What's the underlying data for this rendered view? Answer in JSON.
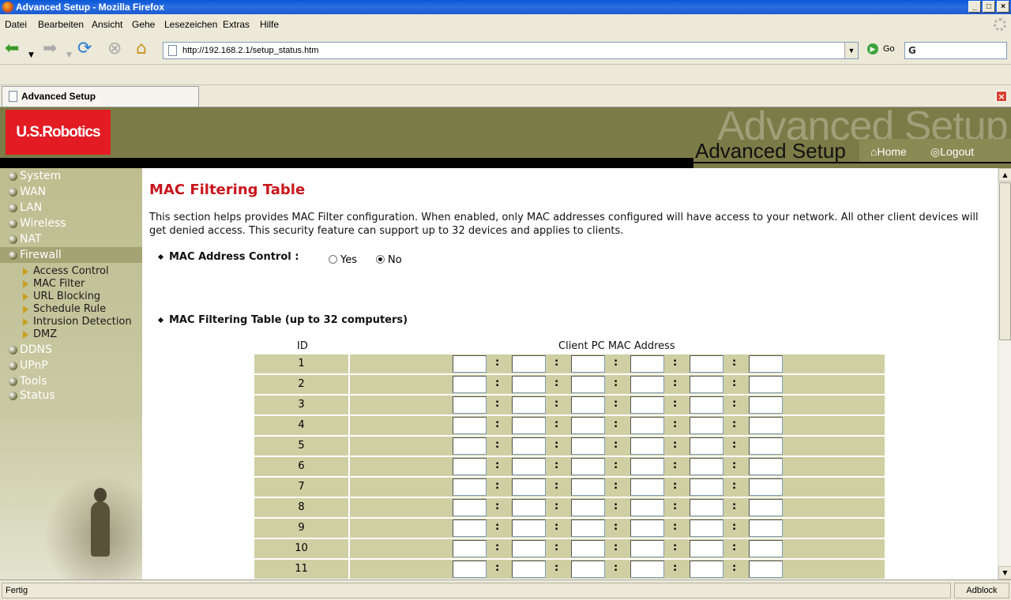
{
  "window": {
    "title": "Advanced Setup - Mozilla Firefox"
  },
  "menu": [
    "Datei",
    "Bearbeiten",
    "Ansicht",
    "Gehe",
    "Lesezeichen",
    "Extras",
    "Hilfe"
  ],
  "toolbar": {
    "url": "http://192.168.2.1/setup_status.htm",
    "go_label": "Go",
    "search_value": "G"
  },
  "tab": {
    "label": "Advanced Setup"
  },
  "header": {
    "logo": "U.S.Robotics",
    "watermark": "Advanced Setup",
    "title": "Advanced Setup",
    "home": "Home",
    "logout": "Logout"
  },
  "sidebar": {
    "items": [
      "System",
      "WAN",
      "LAN",
      "Wireless",
      "NAT",
      "Firewall"
    ],
    "subitems": [
      "Access Control",
      "MAC Filter",
      "URL Blocking",
      "Schedule Rule",
      "Intrusion Detection",
      "DMZ"
    ],
    "items2": [
      "DDNS",
      "UPnP",
      "Tools",
      "Status"
    ],
    "active": "Firewall"
  },
  "main": {
    "title": "MAC Filtering Table",
    "description": "This section helps provides MAC Filter configuration. When enabled, only MAC addresses configured will have access to your network. All other client devices will get denied access. This security feature can support up to 32 devices and applies to clients.",
    "control_label": "MAC Address Control :",
    "yes_label": "Yes",
    "no_label": "No",
    "selected": "No",
    "table_label": "MAC Filtering Table (up to 32 computers)",
    "col_id": "ID",
    "col_mac": "Client PC MAC Address",
    "rows": [
      "1",
      "2",
      "3",
      "4",
      "5",
      "6",
      "7",
      "8",
      "9",
      "10",
      "11"
    ]
  },
  "status": {
    "left": "Fertig",
    "right": "Adblock"
  }
}
